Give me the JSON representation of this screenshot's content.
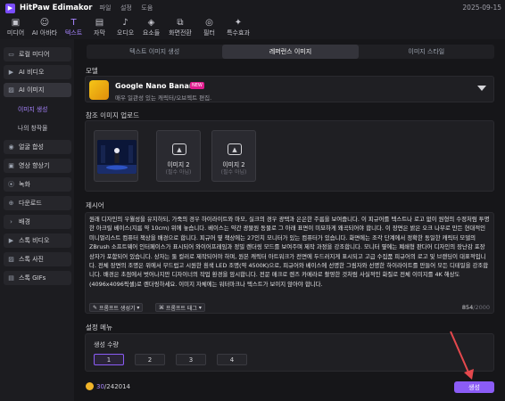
{
  "app": {
    "name": "HitPaw Edimakor",
    "menu": [
      "파일",
      "설정",
      "도움"
    ],
    "date": "2025-09-15"
  },
  "toolbar": [
    {
      "label": "미디어",
      "icon": "media-icon"
    },
    {
      "label": "AI 아바타",
      "icon": "avatar-icon"
    },
    {
      "label": "텍스트",
      "icon": "text-icon"
    },
    {
      "label": "자막",
      "icon": "subtitle-icon"
    },
    {
      "label": "오디오",
      "icon": "audio-icon"
    },
    {
      "label": "요소들",
      "icon": "elements-icon"
    },
    {
      "label": "화면전환",
      "icon": "transition-icon"
    },
    {
      "label": "필터",
      "icon": "filter-icon"
    },
    {
      "label": "특수효과",
      "icon": "effects-icon"
    }
  ],
  "sidebar": {
    "items": [
      "로컬 미디어",
      "AI 비디오",
      "AI 이미지",
      "얼굴 합성",
      "영상 향상기",
      "녹화",
      "다운로드",
      "배경",
      "스톡 비디오",
      "스톡 사진",
      "스톡 GIFs"
    ],
    "subitems": [
      "이미지 생성",
      "나의 창작물"
    ]
  },
  "tabs": [
    "텍스트 이미지 생성",
    "레퍼런스 이미지",
    "이미지 스타일"
  ],
  "model": {
    "section": "모델",
    "name": "Google Nano Banana",
    "badge": "NEW",
    "description": "매우 일관성 있는 캐릭터/오브젝트 편집."
  },
  "reference": {
    "section": "참조 이미지 업로드",
    "cards": [
      {
        "title": "이미지 2",
        "note": "(필수 아님)"
      },
      {
        "title": "이미지 2",
        "note": "(필수 아님)"
      }
    ]
  },
  "prompt": {
    "section": "제시어",
    "text": "원래 디자인의 우월성을 유지하되, 가죽의 경우 하이라이트와 마모, 실크의 경우 광택과 은은한 주름을 보여줍니다. 이 피규어를 텍스트나 로고 없이 원형의 수정처럼 투명한 아크릴 베이스(지름 약 10cm) 위에 놓습니다. 베이스는 약간 광물원 동물로 그 아래 표면이 미묘하게 왜곡되어야 합니다. 이 장면은 밝은 오크 나무로 만든 현대적인 미니멀리스트 컴퓨터 책상을 배경으로 합니다. 피규어 옆 책상에는 27인치 모니터가 있는 컴퓨터가 있습니다. 화면에는 조각 단계에서 정확한 동일한 캐릭터 모델의 ZBrush 소프트웨어 인터페이스가 표시되어 와이어프레임과 정밀 렌더링 모드를 보여주며 제작 과정을 강조합니다. 모니터 옆에는 폐쇄형 판다어 디자인의 장난감 포장 상자가 포함되어 있습니다. 상자는 둘 컬러로 제작되어야 하며, 원본 캐릭터 아트워크가 전면에 두드러지게 표시되고 고급 수집품 피규어의 로고 및 브랜딩이 대표적입니다. 전체 장면의 조명은 위에서 부드럽고 시원한 흰색 LED 조명(약 4500K)으로, 피규어와 베이스에 선명한 그림자와 선명한 하이라이트를 만들어 모든 디테일을 강조합니다. 배경은 초점에서 벗어나지만 디자이너의 작업 환경을 암시합니다. 전문 매크로 렌즈 카메라로 촬영한 것처럼 사실적인 화질로 전체 이미지를 4K 해상도(4096x4096픽셀)로 렌더링하세요. 이미지 자체에는 워터마크나 텍스트가 보이지 않아야 합니다.",
    "generator_btn": "프롬프트 생성기",
    "tag_btn": "프롬프트 태그",
    "count": "854",
    "max": "/2000"
  },
  "settings": {
    "section": "설정 메뉴",
    "count_label": "생성 수량",
    "options": [
      "1",
      "2",
      "3",
      "4"
    ],
    "selected": "1"
  },
  "footer": {
    "credits_used": "30",
    "credits_total": "/242014",
    "generate": "생성"
  },
  "colors": {
    "accent": "#8b5cf6",
    "active_text": "#a784ff",
    "arrow": "#e5484d"
  }
}
